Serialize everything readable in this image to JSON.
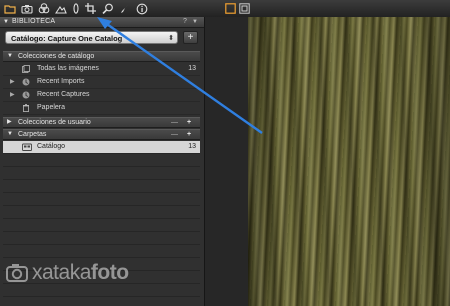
{
  "toolbar": {
    "tools": [
      {
        "icon": "folder-icon"
      },
      {
        "icon": "camera-icon"
      },
      {
        "icon": "color-balance-icon"
      },
      {
        "icon": "exposure-icon"
      },
      {
        "icon": "lens-icon"
      },
      {
        "icon": "crop-icon"
      },
      {
        "icon": "magnifier-icon"
      },
      {
        "icon": "pen-icon"
      },
      {
        "icon": "info-icon"
      }
    ],
    "right_buttons": [
      "browser-view-icon",
      "viewer-view-icon"
    ]
  },
  "panel": {
    "title": "BIBLIOTECA",
    "help": "?",
    "catalog_select": {
      "value": "Catálogo: Capture One Catalog"
    },
    "catalog_collections": {
      "title": "Colecciones de catálogo",
      "items": [
        {
          "label": "Todas las imágenes",
          "count": "13",
          "icon": "images-icon"
        },
        {
          "label": "Recent Imports",
          "count": "",
          "icon": "recent-imports-icon"
        },
        {
          "label": "Recent Captures",
          "count": "",
          "icon": "recent-captures-icon"
        },
        {
          "label": "Papelera",
          "count": "",
          "icon": "trash-icon"
        }
      ]
    },
    "user_collections": {
      "title": "Colecciones de usuario",
      "minus": "—",
      "plus": "+"
    },
    "folders": {
      "title": "Carpetas",
      "minus": "—",
      "plus": "+",
      "items": [
        {
          "label": "Catálogo",
          "count": "13",
          "icon": "catalog-icon",
          "selected": true
        }
      ]
    }
  },
  "watermark": {
    "text_regular": "xataka",
    "text_bold": "foto"
  },
  "colors": {
    "arrow": "#2f7fe0",
    "panel_bg": "#303030",
    "selected_row": "#d6d6d6"
  }
}
